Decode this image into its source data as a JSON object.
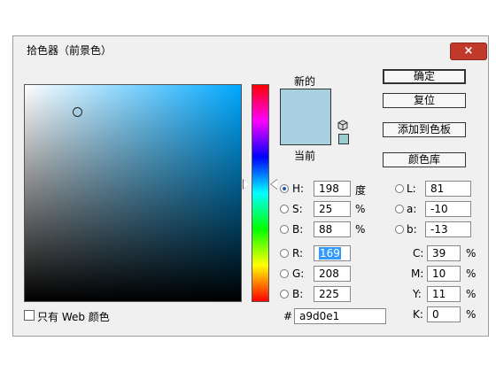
{
  "window": {
    "title": "拾色器（前景色）",
    "close_icon": "×"
  },
  "preview": {
    "new_label": "新的",
    "current_label": "当前",
    "new_color": "#a9d0e1",
    "current_color": "#a9d0e1",
    "websafe_color": "#99cccc"
  },
  "buttons": {
    "ok": "确定",
    "reset": "复位",
    "add_to_swatches": "添加到色板",
    "color_libraries": "颜色库"
  },
  "hsb": {
    "h": {
      "label": "H:",
      "value": "198",
      "unit": "度"
    },
    "s": {
      "label": "S:",
      "value": "25",
      "unit": "%"
    },
    "b": {
      "label": "B:",
      "value": "88",
      "unit": "%"
    }
  },
  "rgb": {
    "r": {
      "label": "R:",
      "value": "169"
    },
    "g": {
      "label": "G:",
      "value": "208"
    },
    "b": {
      "label": "B:",
      "value": "225"
    }
  },
  "lab": {
    "l": {
      "label": "L:",
      "value": "81"
    },
    "a": {
      "label": "a:",
      "value": "-10"
    },
    "b": {
      "label": "b:",
      "value": "-13"
    }
  },
  "cmyk": {
    "c": {
      "label": "C:",
      "value": "39",
      "unit": "%"
    },
    "m": {
      "label": "M:",
      "value": "10",
      "unit": "%"
    },
    "y": {
      "label": "Y:",
      "value": "11",
      "unit": "%"
    },
    "k": {
      "label": "K:",
      "value": "0",
      "unit": "%"
    }
  },
  "hex": {
    "label": "#",
    "value": "a9d0e1"
  },
  "web_only": {
    "label": "只有 Web 颜色",
    "checked": false
  }
}
